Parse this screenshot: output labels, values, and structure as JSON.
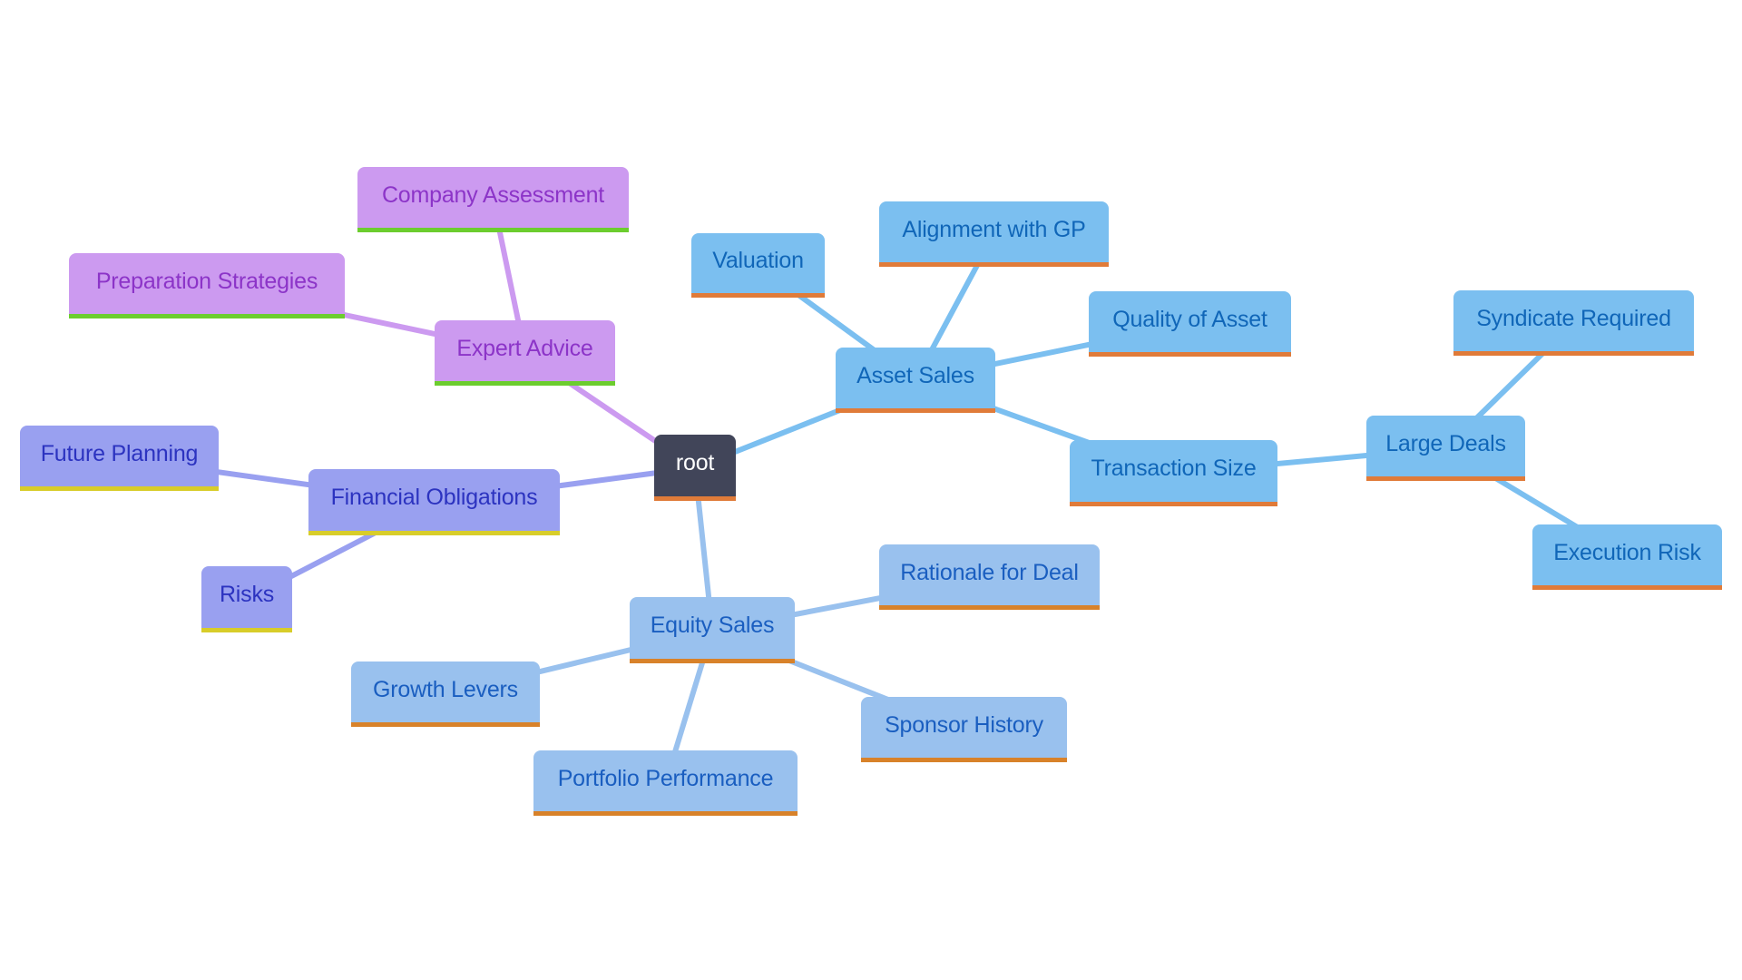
{
  "diagram": {
    "type": "mindmap",
    "colors": {
      "background": "#ffffff",
      "root_fill": "#414559",
      "root_text": "#ffffff",
      "accent_orange": "#e07b39",
      "expert_fill": "#cc9af0",
      "expert_text": "#8c34c8",
      "expert_edge": "#cc9af0",
      "expert_underline": "#6ccd2e",
      "financial_fill": "#99a0f0",
      "financial_text": "#2c33c0",
      "financial_edge": "#99a0f0",
      "financial_underline": "#d8cd2a",
      "asset_fill": "#7bbff0",
      "asset_text": "#1066b8",
      "asset_edge": "#7bbff0",
      "equity_fill": "#99c1ee",
      "equity_text": "#1a5ec0",
      "equity_edge": "#99c1ee"
    },
    "root": {
      "label": "root",
      "children": [
        {
          "label": "Expert Advice",
          "children": [
            {
              "label": "Company Assessment"
            },
            {
              "label": "Preparation Strategies"
            }
          ]
        },
        {
          "label": "Financial Obligations",
          "children": [
            {
              "label": "Future Planning"
            },
            {
              "label": "Risks"
            }
          ]
        },
        {
          "label": "Asset Sales",
          "children": [
            {
              "label": "Valuation"
            },
            {
              "label": "Alignment with GP"
            },
            {
              "label": "Quality of Asset"
            },
            {
              "label": "Transaction Size",
              "children": [
                {
                  "label": "Large Deals",
                  "children": [
                    {
                      "label": "Syndicate Required"
                    },
                    {
                      "label": "Execution Risk"
                    }
                  ]
                }
              ]
            }
          ]
        },
        {
          "label": "Equity Sales",
          "children": [
            {
              "label": "Rationale for Deal"
            },
            {
              "label": "Growth Levers"
            },
            {
              "label": "Sponsor History"
            },
            {
              "label": "Portfolio Performance"
            }
          ]
        }
      ]
    }
  }
}
